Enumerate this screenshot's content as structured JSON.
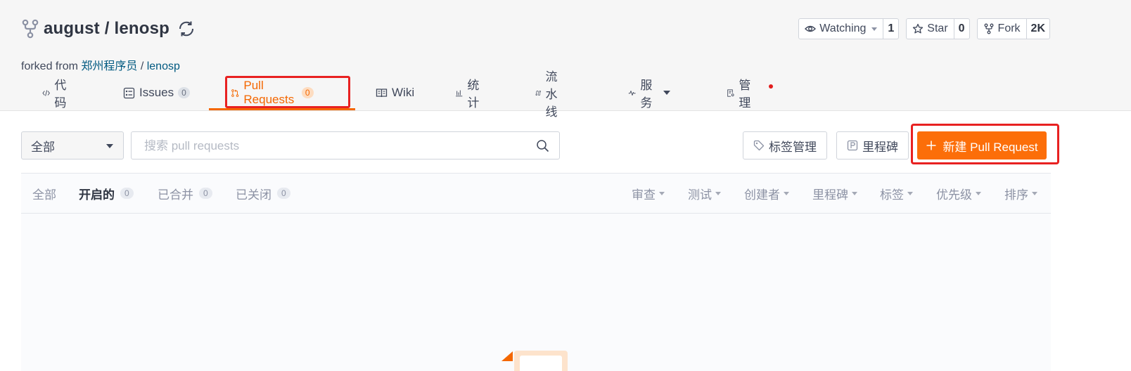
{
  "repo": {
    "owner": "august",
    "separator": " / ",
    "name": "lenosp",
    "forked_prefix": "forked from ",
    "forked_owner": "郑州程序员",
    "forked_sep": " / ",
    "forked_name": "lenosp"
  },
  "actions": {
    "watch_label": "Watching",
    "watch_count": "1",
    "star_label": "Star",
    "star_count": "0",
    "fork_label": "Fork",
    "fork_count": "2K"
  },
  "tabs": [
    {
      "label": "代码",
      "icon": "code-icon"
    },
    {
      "label": "Issues",
      "badge": "0",
      "icon": "issues-icon"
    },
    {
      "label": "Pull Requests",
      "badge": "0",
      "icon": "pull-request-icon",
      "active": true
    },
    {
      "label": "Wiki",
      "icon": "wiki-icon"
    },
    {
      "label": "统计",
      "icon": "stats-icon"
    },
    {
      "label": "流水线",
      "icon": "pipeline-icon"
    },
    {
      "label": "服务",
      "icon": "service-icon"
    },
    {
      "label": "管理",
      "icon": "manage-icon"
    }
  ],
  "toolbar": {
    "scope_select": "全部",
    "search_placeholder": "搜索 pull requests",
    "labels_button": "标签管理",
    "milestone_button": "里程碑",
    "new_pr_button": "新建 Pull Request"
  },
  "filters": {
    "all": "全部",
    "open": "开启的",
    "open_count": "0",
    "merged": "已合并",
    "merged_count": "0",
    "closed": "已关闭",
    "closed_count": "0"
  },
  "sorts": [
    "审查",
    "测试",
    "创建者",
    "里程碑",
    "标签",
    "优先级",
    "排序"
  ],
  "colors": {
    "accent": "#fc6e09",
    "active_tab": "#f46700",
    "link": "#005980",
    "highlight": "#e82121"
  }
}
